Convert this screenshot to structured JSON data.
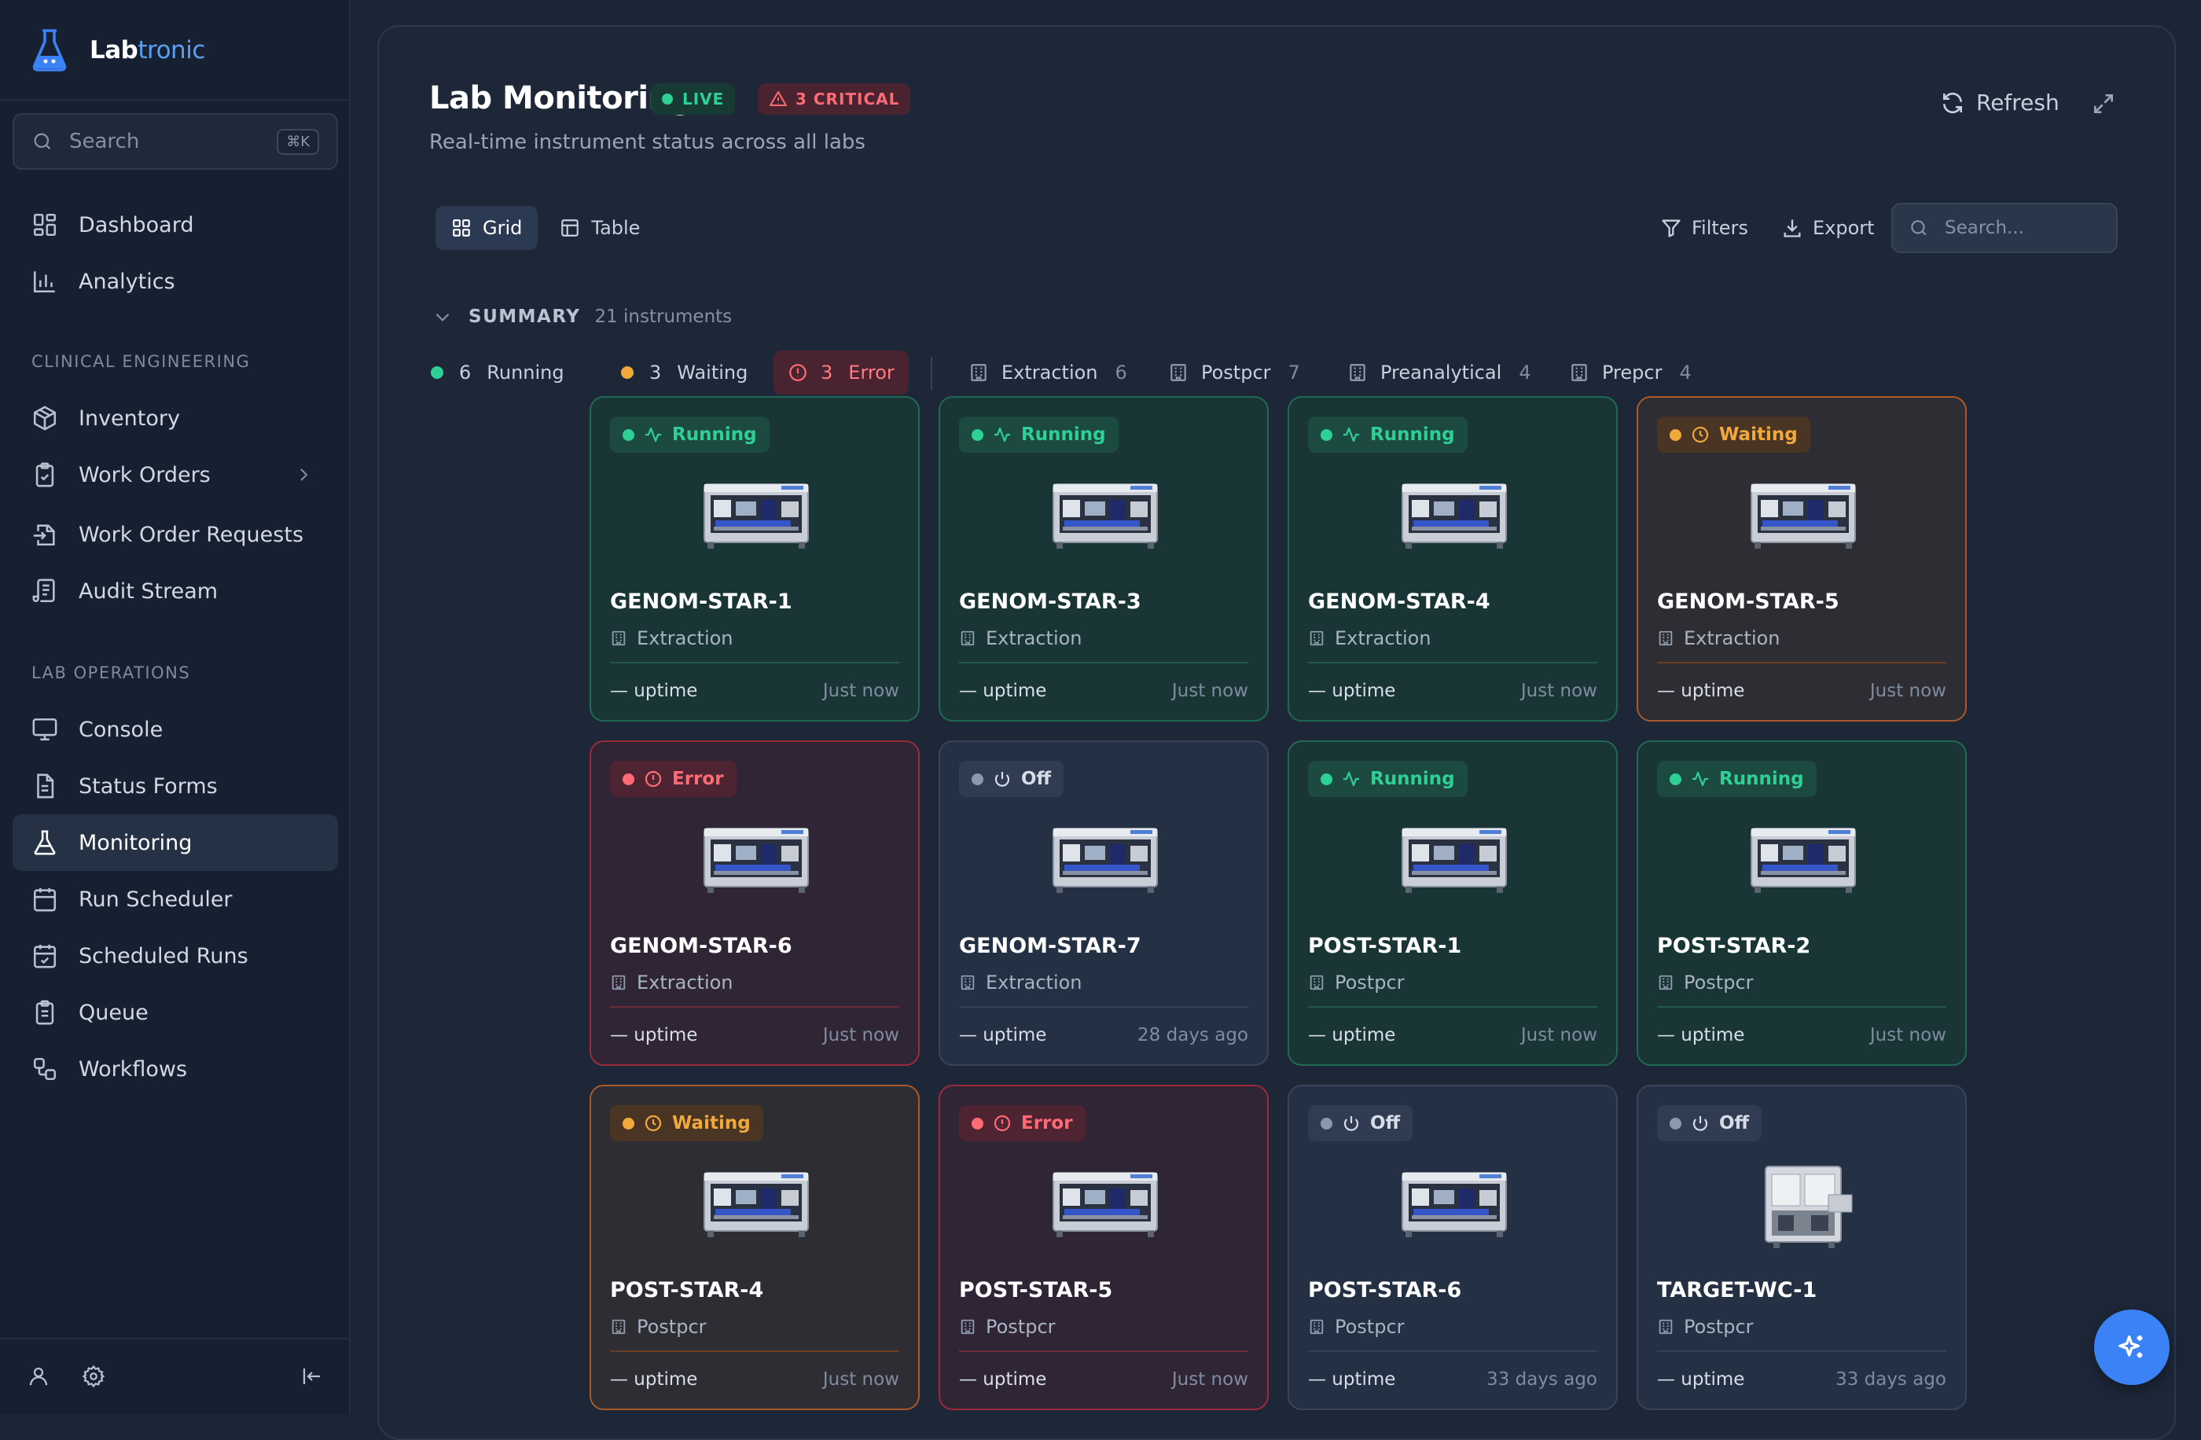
{
  "sidebar": {
    "brand": {
      "part1": "Lab",
      "part2": "tronic"
    },
    "search": {
      "placeholder": "Search",
      "shortcut": "⌘K"
    },
    "top_items": [
      {
        "label": "Dashboard",
        "icon": "dashboard-icon"
      },
      {
        "label": "Analytics",
        "icon": "bar-chart-icon"
      }
    ],
    "sections": [
      {
        "title": "CLINICAL ENGINEERING",
        "items": [
          {
            "label": "Inventory",
            "icon": "box-icon"
          },
          {
            "label": "Work Orders",
            "icon": "clipboard-check-icon",
            "has_submenu": true
          },
          {
            "label": "Work Order Requests",
            "icon": "file-import-icon"
          },
          {
            "label": "Audit Stream",
            "icon": "scroll-icon"
          }
        ]
      },
      {
        "title": "LAB OPERATIONS",
        "items": [
          {
            "label": "Console",
            "icon": "monitor-icon"
          },
          {
            "label": "Status Forms",
            "icon": "file-text-icon"
          },
          {
            "label": "Monitoring",
            "icon": "flask-icon",
            "active": true
          },
          {
            "label": "Run Scheduler",
            "icon": "calendar-icon"
          },
          {
            "label": "Scheduled Runs",
            "icon": "calendar-check-icon"
          },
          {
            "label": "Queue",
            "icon": "clipboard-list-icon"
          },
          {
            "label": "Workflows",
            "icon": "workflow-icon"
          }
        ]
      }
    ]
  },
  "header": {
    "title": "Lab Monitoring",
    "live_label": "LIVE",
    "critical_label": "3 CRITICAL",
    "subtitle": "Real-time instrument status across all labs",
    "refresh_label": "Refresh"
  },
  "toolbar": {
    "views": [
      {
        "label": "Grid",
        "active": true
      },
      {
        "label": "Table",
        "active": false
      }
    ],
    "filters_label": "Filters",
    "export_label": "Export",
    "search_placeholder": "Search..."
  },
  "summary": {
    "label": "SUMMARY",
    "count_text": "21 instruments",
    "status_chips": [
      {
        "count": "6",
        "label": "Running",
        "color": "#2fd096"
      },
      {
        "count": "3",
        "label": "Waiting",
        "color": "#f0a93a"
      },
      {
        "count": "3",
        "label": "Error",
        "color": "#ff6b74"
      }
    ],
    "lab_chips": [
      {
        "label": "Extraction",
        "count": "6"
      },
      {
        "label": "Postpcr",
        "count": "7"
      },
      {
        "label": "Preanalytical",
        "count": "4"
      },
      {
        "label": "Prepcr",
        "count": "4"
      }
    ]
  },
  "instruments": [
    {
      "name": "GENOM-STAR-1",
      "status": "Running",
      "lab": "Extraction",
      "uptime": "— uptime",
      "last_seen": "Just now"
    },
    {
      "name": "GENOM-STAR-3",
      "status": "Running",
      "lab": "Extraction",
      "uptime": "— uptime",
      "last_seen": "Just now"
    },
    {
      "name": "GENOM-STAR-4",
      "status": "Running",
      "lab": "Extraction",
      "uptime": "— uptime",
      "last_seen": "Just now"
    },
    {
      "name": "GENOM-STAR-5",
      "status": "Waiting",
      "lab": "Extraction",
      "uptime": "— uptime",
      "last_seen": "Just now"
    },
    {
      "name": "GENOM-STAR-6",
      "status": "Error",
      "lab": "Extraction",
      "uptime": "— uptime",
      "last_seen": "Just now"
    },
    {
      "name": "GENOM-STAR-7",
      "status": "Off",
      "lab": "Extraction",
      "uptime": "— uptime",
      "last_seen": "28 days ago"
    },
    {
      "name": "POST-STAR-1",
      "status": "Running",
      "lab": "Postpcr",
      "uptime": "— uptime",
      "last_seen": "Just now"
    },
    {
      "name": "POST-STAR-2",
      "status": "Running",
      "lab": "Postpcr",
      "uptime": "— uptime",
      "last_seen": "Just now"
    },
    {
      "name": "POST-STAR-4",
      "status": "Waiting",
      "lab": "Postpcr",
      "uptime": "— uptime",
      "last_seen": "Just now"
    },
    {
      "name": "POST-STAR-5",
      "status": "Error",
      "lab": "Postpcr",
      "uptime": "— uptime",
      "last_seen": "Just now"
    },
    {
      "name": "POST-STAR-6",
      "status": "Off",
      "lab": "Postpcr",
      "uptime": "— uptime",
      "last_seen": "33 days ago"
    },
    {
      "name": "TARGET-WC-1",
      "status": "Off",
      "lab": "Postpcr",
      "uptime": "— uptime",
      "last_seen": "33 days ago"
    }
  ]
}
